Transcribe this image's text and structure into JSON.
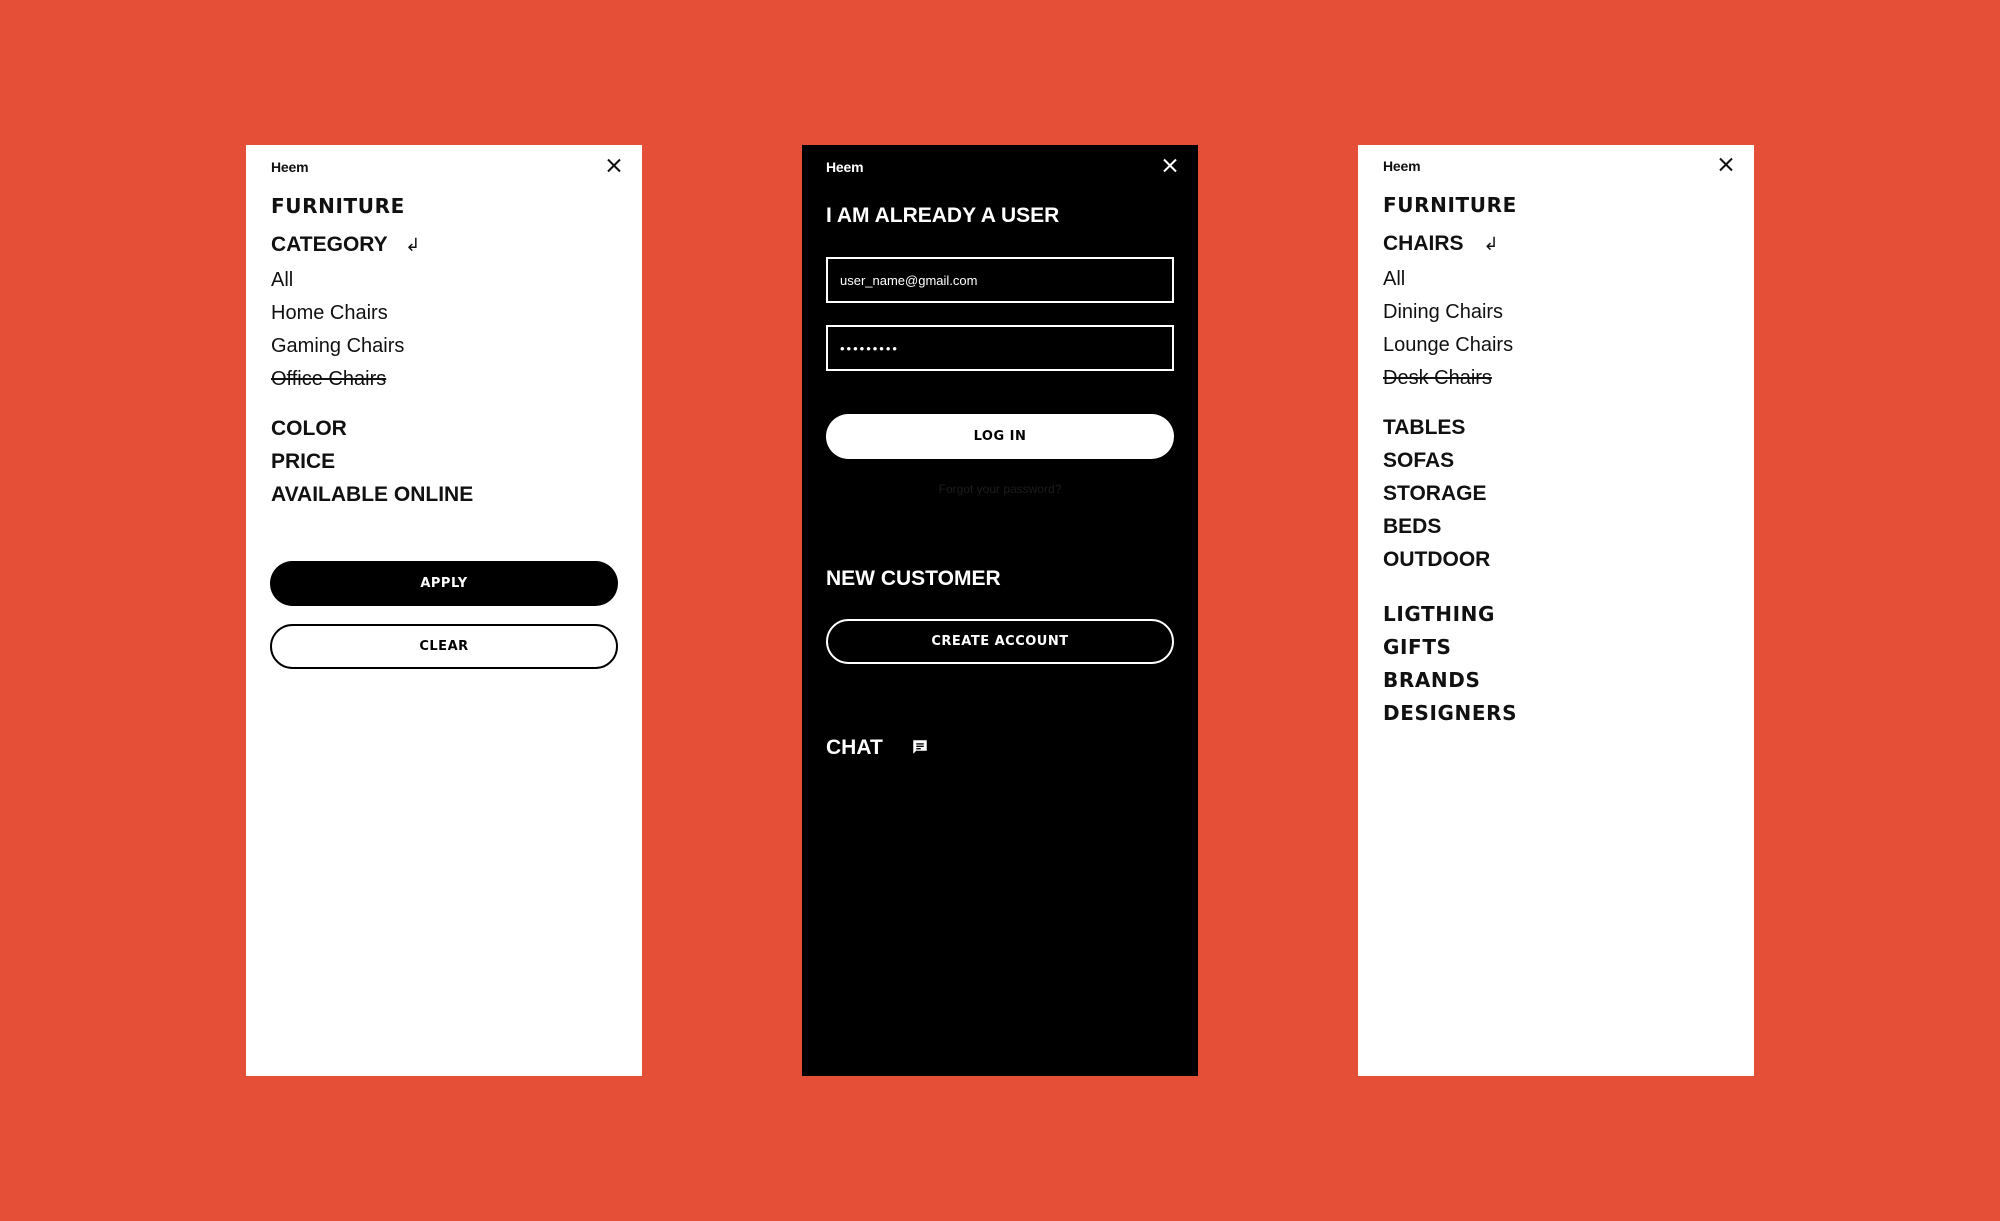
{
  "colors": {
    "background": "#e64f37",
    "light_panel": "#ffffff",
    "dark_panel": "#000000",
    "text_dark": "#111111",
    "text_light": "#ffffff"
  },
  "filter_panel": {
    "brand": "Heem",
    "close_icon": "close-icon",
    "title": "FURNITURE",
    "category_heading": "CATEGORY",
    "back_icon": "return-arrow-icon",
    "back_glyph": "↲",
    "items": [
      "All",
      "Home Chairs",
      "Gaming Chairs",
      "Office Chairs"
    ],
    "struck_item": "Office Chairs",
    "sections": [
      "COLOR",
      "PRICE",
      "AVAILABLE ONLINE"
    ],
    "apply_label": "APPLY",
    "clear_label": "CLEAR"
  },
  "login_panel": {
    "brand": "Heem",
    "close_icon": "close-icon",
    "existing_user_heading": "I AM ALREADY A USER",
    "email_value": "user_name@gmail.com",
    "password_value": "•••••••••",
    "login_label": "LOG IN",
    "forgot_password": "Forgot your password?",
    "new_customer_heading": "NEW CUSTOMER",
    "create_account_label": "CREATE ACCOUNT",
    "chat_label": "CHAT",
    "chat_icon": "chat-bubble-icon"
  },
  "menu_panel": {
    "brand": "Heem",
    "close_icon": "close-icon",
    "title": "FURNITURE",
    "chairs_heading": "CHAIRS",
    "back_icon": "return-arrow-icon",
    "back_glyph": "↲",
    "chair_items": [
      "All",
      "Dining Chairs",
      "Lounge Chairs",
      "Desk Chairs"
    ],
    "struck_item": "Desk Chairs",
    "furniture_sections": [
      "TABLES",
      "SOFAS",
      "STORAGE",
      "BEDS",
      "OUTDOOR"
    ],
    "main_sections": [
      "LIGTHING",
      "GIFTS",
      "BRANDS",
      "DESIGNERS"
    ]
  }
}
